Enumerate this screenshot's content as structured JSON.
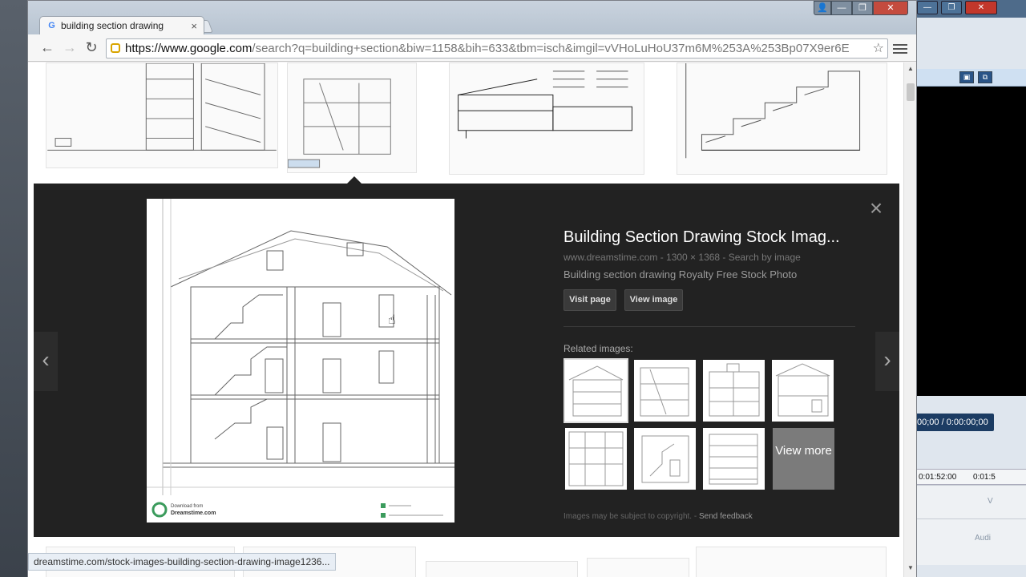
{
  "browser": {
    "tab_title": "building section drawing",
    "tab_close": "×",
    "url_host": "https://www.google.com",
    "url_path": "/search?q=building+section&biw=1158&bih=633&tbm=isch&imgil=vVHoLuHoU37m6M%253A%253Bp07X9er6E",
    "star": "☆"
  },
  "preview": {
    "title": "Building Section Drawing Stock Imag...",
    "meta": "www.dreamstime.com - 1300 × 1368 - Search by image",
    "description": "Building section drawing Royalty Free Stock Photo",
    "visit_page": "Visit page",
    "view_image": "View image",
    "related_label": "Related images:",
    "view_more": "View more",
    "copyright": "Images may be subject to copyright.",
    "separator": " - ",
    "send_feedback": "Send feedback",
    "close": "×",
    "prev": "‹",
    "next": "›"
  },
  "watermark": {
    "download_from": "Download from",
    "site": "Dreamstime.com"
  },
  "status_url": "dreamstime.com/stock-images-building-section-drawing-image1236...",
  "background_app": {
    "timecode": "00;00 / 0:00:00;00",
    "ruler_a": "0:01:52:00",
    "ruler_b": "0:01:5",
    "track_label_1": "V",
    "track_label_2": "Audi"
  },
  "colors": {
    "panel": "#222222",
    "accent_gold": "#d9a400"
  }
}
